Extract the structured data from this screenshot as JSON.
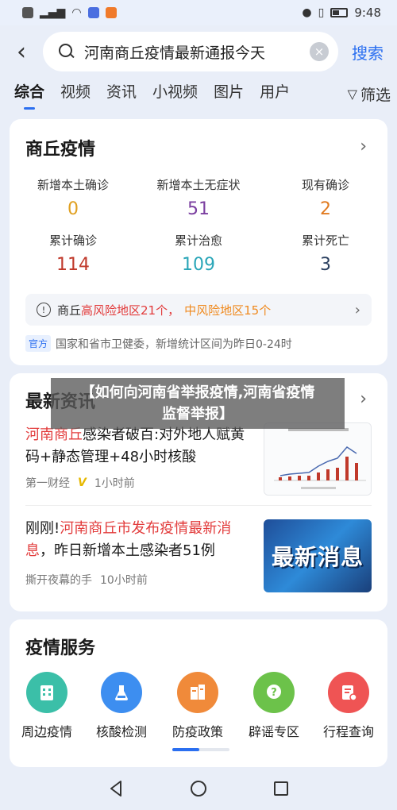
{
  "status_bar": {
    "time": "9:48"
  },
  "search": {
    "back_label": "‹",
    "query": "河南商丘疫情最新通报今天",
    "clear_label": "×",
    "submit_label": "搜索"
  },
  "tabs": [
    {
      "label": "综合"
    },
    {
      "label": "视频"
    },
    {
      "label": "资讯"
    },
    {
      "label": "小视频"
    },
    {
      "label": "图片"
    },
    {
      "label": "用户"
    }
  ],
  "filter_label": "筛选",
  "epidemic": {
    "title": "商丘疫情",
    "stats": [
      {
        "label": "新增本土确诊",
        "value": "0",
        "color": "#e0a020"
      },
      {
        "label": "新增本土无症状",
        "value": "51",
        "color": "#7b3fa0"
      },
      {
        "label": "现有确诊",
        "value": "2",
        "color": "#e07a20"
      },
      {
        "label": "累计确诊",
        "value": "114",
        "color": "#c0392b"
      },
      {
        "label": "累计治愈",
        "value": "109",
        "color": "#2aa6b8"
      },
      {
        "label": "累计死亡",
        "value": "3",
        "color": "#2a3f5f"
      }
    ],
    "risk_prefix": "商丘",
    "risk_high": "高风险地区21个",
    "risk_sep": "，",
    "risk_mid": "中风险地区15个",
    "official_badge": "官方",
    "source_text": "国家和省市卫健委，新增统计区间为昨日0-24时"
  },
  "news": {
    "title": "最新资讯",
    "items": [
      {
        "highlight": "河南商丘",
        "rest": "感染者破百:对外地人赋黄码+静态管理+48小时核酸",
        "source": "第一财经",
        "badge": "V",
        "time": "1小时前"
      },
      {
        "prefix": "刚刚!",
        "highlight": "河南商丘市发布疫情最新消息",
        "rest": "，昨日新增本土感染者51例",
        "source": "撕开夜幕的手",
        "time": "10小时前",
        "thumb_text": "最新消息"
      }
    ]
  },
  "banner": {
    "line1": "【如何向河南省举报疫情,河南省疫情",
    "line2": "监督举报】"
  },
  "services": {
    "title": "疫情服务",
    "items": [
      {
        "label": "周边疫情",
        "icon": "building-icon",
        "color": "#3bbfa8"
      },
      {
        "label": "核酸检测",
        "icon": "flask-icon",
        "color": "#3d8ef0"
      },
      {
        "label": "防疫政策",
        "icon": "policy-icon",
        "color": "#f08a3a"
      },
      {
        "label": "辟谣专区",
        "icon": "question-icon",
        "color": "#6cc24a"
      },
      {
        "label": "行程查询",
        "icon": "itinerary-icon",
        "color": "#ef5454"
      }
    ]
  }
}
